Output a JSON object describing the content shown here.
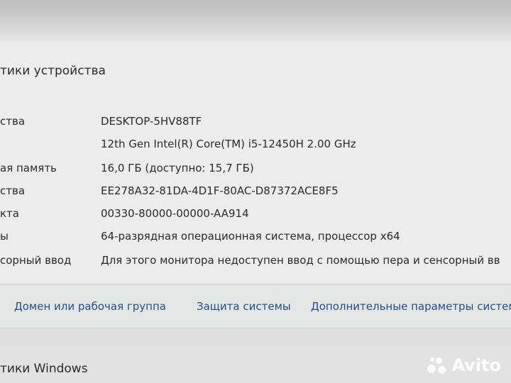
{
  "device_specs": {
    "title": "тики устройства",
    "rows": [
      {
        "label": "ства",
        "value": "DESKTOP-5HV88TF"
      },
      {
        "label": "",
        "value": "12th Gen Intel(R) Core(TM) i5-12450H   2.00 GHz"
      },
      {
        "label": "ая память",
        "value": "16,0 ГБ (доступно: 15,7 ГБ)"
      },
      {
        "label": "ства",
        "value": "EE278A32-81DA-4D1F-80AC-D87372ACE8F5"
      },
      {
        "label": "кта",
        "value": "00330-80000-00000-AA914"
      },
      {
        "label": "ы",
        "value": "64-разрядная операционная система, процессор x64"
      },
      {
        "label": "сорный ввод",
        "value": "Для этого монитора недоступен ввод с помощью пера и сенсорный вв"
      }
    ]
  },
  "related_links": {
    "domain": "Домен или рабочая группа",
    "protection": "Защита системы",
    "advanced": "Дополнительные параметры систем"
  },
  "windows_specs": {
    "title": "тики Windows"
  },
  "watermark": {
    "text": "Avito"
  }
}
